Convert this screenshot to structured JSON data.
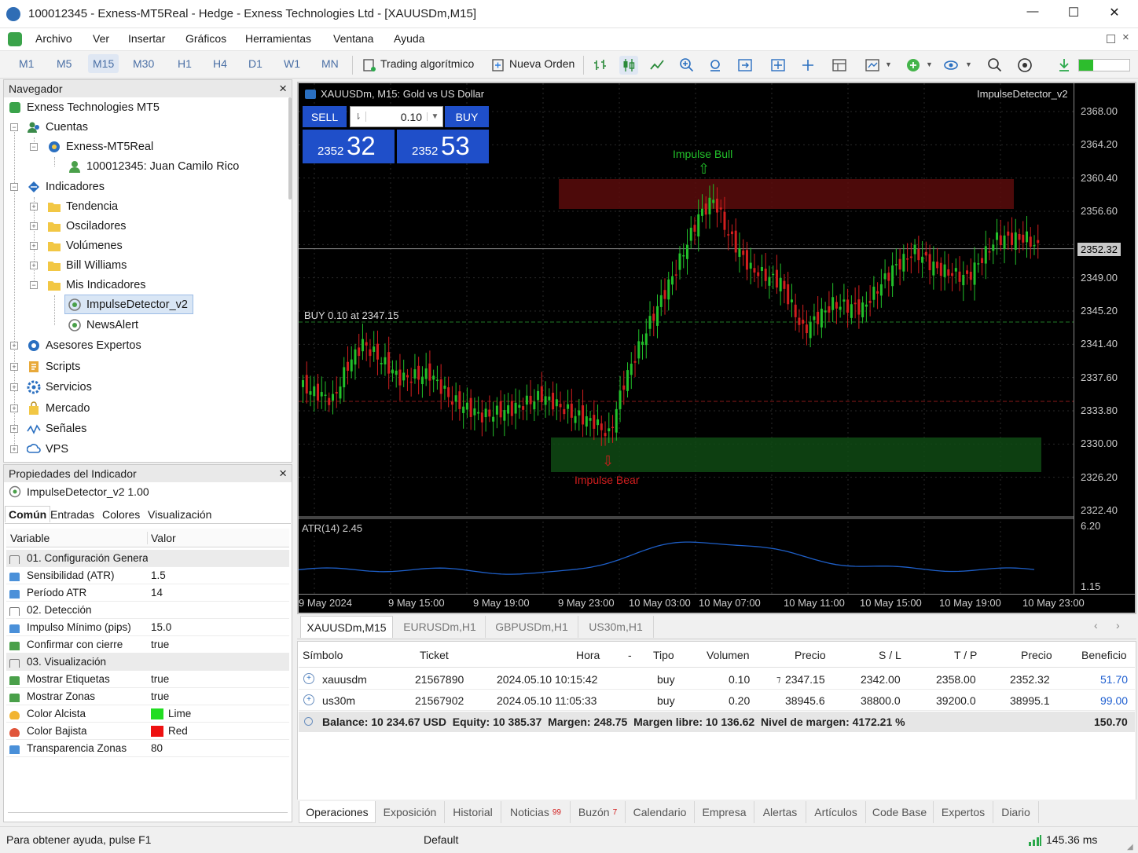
{
  "window": {
    "title": "100012345 - Exness-MT5Real - Hedge - Exness Technologies Ltd - [XAUUSDm,M15]",
    "controls": [
      "—",
      "☐",
      "✕"
    ]
  },
  "menu": [
    "Archivo",
    "Ver",
    "Insertar",
    "Gráficos",
    "Herramientas",
    "Ventana",
    "Ayuda"
  ],
  "toolbar": {
    "timeframes": [
      "M1",
      "M5",
      "M15",
      "M30",
      "H1",
      "H4",
      "D1",
      "W1",
      "MN"
    ],
    "active_timeframe": "M15",
    "algo_label": "Trading algorítmico",
    "order_label": "Nueva Orden",
    "badge": "!"
  },
  "navigator": {
    "title": "Navegador",
    "close": "×",
    "items": [
      {
        "label": "Exness Technologies MT5",
        "icon": "terminal-icon"
      },
      {
        "label": "Cuentas",
        "icon": "accounts-icon"
      },
      {
        "label": "Exness-MT5Real",
        "icon": "server-icon"
      },
      {
        "label": "100012345: Juan Camilo Rico",
        "icon": "user-icon"
      },
      {
        "label": "Indicadores",
        "icon": "indicators-icon"
      },
      {
        "label": "Tendencia",
        "icon": "folder-icon"
      },
      {
        "label": "Osciladores",
        "icon": "folder-icon"
      },
      {
        "label": "Volúmenes",
        "icon": "folder-icon"
      },
      {
        "label": "Bill Williams",
        "icon": "folder-icon"
      },
      {
        "label": "Mis Indicadores",
        "icon": "folder-icon"
      },
      {
        "label": "ImpulseDetector_v2",
        "icon": "indicator-file-icon"
      },
      {
        "label": "NewsAlert",
        "icon": "indicator-file-icon"
      },
      {
        "label": "Asesores Expertos",
        "icon": "experts-icon"
      },
      {
        "label": "Scripts",
        "icon": "scripts-icon"
      },
      {
        "label": "Servicios",
        "icon": "services-icon"
      },
      {
        "label": "Mercado",
        "icon": "market-icon"
      },
      {
        "label": "Señales",
        "icon": "signals-icon"
      },
      {
        "label": "VPS",
        "icon": "vps-icon"
      }
    ]
  },
  "properties": {
    "title": "Propiedades del Indicador",
    "close": "×",
    "indicator_name": "ImpulseDetector_v2 1.00",
    "tabs": [
      "Común",
      "Entradas",
      "Colores",
      "Visualización"
    ],
    "active_tab": "Común",
    "col_variable": "Variable",
    "col_value": "Valor",
    "rows": [
      {
        "name": "01. Configuración General",
        "value": "",
        "section": true
      },
      {
        "name": "Sensibilidad (ATR)",
        "value": "1.5"
      },
      {
        "name": "Período ATR",
        "value": "14"
      },
      {
        "name": "02. Detección",
        "value": "",
        "section": true
      },
      {
        "name": "Impulso Mínimo (pips)",
        "value": "15.0"
      },
      {
        "name": "Confirmar con cierre",
        "value": "true"
      },
      {
        "name": "03. Visualización",
        "value": "",
        "section": true
      },
      {
        "name": "Mostrar Etiquetas",
        "value": "true"
      },
      {
        "name": "Mostrar Zonas",
        "value": "true"
      },
      {
        "name": "Color Alcista",
        "value": "Lime",
        "swatch": "#22dd22"
      },
      {
        "name": "Color Bajista",
        "value": "Red",
        "swatch": "#ee1111"
      },
      {
        "name": "Transparencia Zonas",
        "value": "80"
      }
    ]
  },
  "chart": {
    "header": "XAUUSDm, M15: Gold vs US Dollar",
    "indicator_label": "ImpulseDetector_v2",
    "sell_label": "SELL",
    "buy_label": "BUY",
    "volume": "0.10",
    "sell_price_small": "2352",
    "sell_price_big": "32",
    "buy_price_small": "2352",
    "buy_price_big": "53",
    "impulse_bull": "Impulse Bull",
    "impulse_bear": "Impulse Bear",
    "buy_line_label": "BUY 0.10 at 2347.15",
    "atr_label": "ATR(14) 2.45",
    "current_price": "2352.32",
    "colors": {
      "bull": "#22c02a",
      "bear": "#d21e1e",
      "atr": "#1e5fc8"
    }
  },
  "chart_data": {
    "type": "candlestick",
    "y_axis_ticks": [
      "2368.00",
      "2364.20",
      "2360.40",
      "2356.60",
      "2352.32",
      "2349.00",
      "2345.20",
      "2341.40",
      "2337.60",
      "2333.80",
      "2330.00",
      "2326.20",
      "2322.40"
    ],
    "atr_axis_ticks": [
      "6.20",
      "1.15"
    ],
    "x_axis_ticks": [
      "9 May 2024",
      "9 May 15:00",
      "9 May 19:00",
      "9 May 23:00",
      "10 May 03:00",
      "10 May 07:00",
      "10 May 11:00",
      "10 May 15:00",
      "10 May 19:00",
      "10 May 23:00"
    ]
  },
  "symbol_tabs": [
    "XAUUSDm,M15",
    "EURUSDm,H1",
    "GBPUSDm,H1",
    "US30m,H1"
  ],
  "trade_table": {
    "headers": [
      "Símbolo",
      "Ticket",
      "Hora",
      "-",
      "Tipo",
      "Volumen",
      "Precio",
      "S / L",
      "T / P",
      "Precio",
      "Beneficio"
    ],
    "rows": [
      {
        "symbol": "xauusdm",
        "ticket": "21567890",
        "time": "2024.05.10 10:15:42",
        "type": "buy",
        "volume": "0.10",
        "price": "2347.15",
        "sl": "2342.00",
        "tp": "2358.00",
        "current": "2352.32",
        "profit": "51.70"
      },
      {
        "symbol": "us30m",
        "ticket": "21567902",
        "time": "2024.05.10 11:05:33",
        "type": "buy",
        "volume": "0.20",
        "price": "38945.6",
        "sl": "38800.0",
        "tp": "39200.0",
        "current": "38995.1",
        "profit": "99.00"
      }
    ],
    "balance_line": "Balance: 10 234.67 USD  Equity: 10 385.37  Margen: 248.75  Margen libre: 10 136.62  Nivel de margen: 4172.21 %",
    "total_profit": "150.70"
  },
  "bottom_tabs": [
    {
      "label": "Operaciones",
      "badge": ""
    },
    {
      "label": "Exposición",
      "badge": ""
    },
    {
      "label": "Historial",
      "badge": ""
    },
    {
      "label": "Noticias",
      "badge": "99"
    },
    {
      "label": "Buzón",
      "badge": "7"
    },
    {
      "label": "Calendario",
      "badge": ""
    },
    {
      "label": "Empresa",
      "badge": ""
    },
    {
      "label": "Alertas",
      "badge": ""
    },
    {
      "label": "Artículos",
      "badge": ""
    },
    {
      "label": "Code Base",
      "badge": ""
    },
    {
      "label": "Expertos",
      "badge": ""
    },
    {
      "label": "Diario",
      "badge": ""
    }
  ],
  "status": {
    "help": "Para obtener ayuda, pulse F1",
    "profile": "Default",
    "ping": "145.36 ms"
  }
}
